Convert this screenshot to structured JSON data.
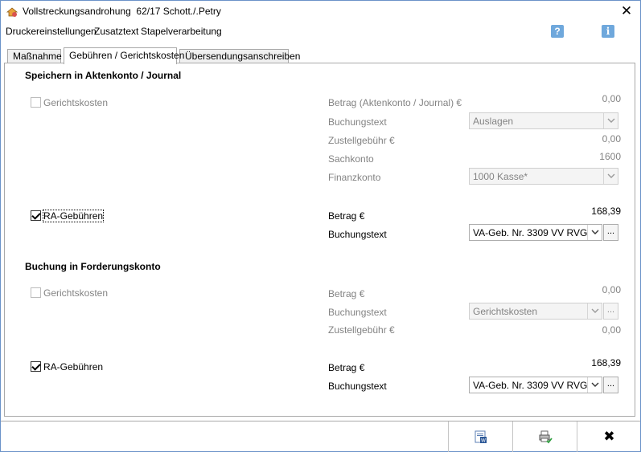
{
  "window": {
    "title": "Vollstreckungsandrohung  62/17 Schott./.Petry",
    "close_glyph": "✕"
  },
  "menu": {
    "items": [
      "Druckereinstellungen",
      "Zusatztext",
      "Stapelverarbeitung"
    ],
    "help_glyph": "?",
    "info_glyph": "i"
  },
  "tabs": [
    {
      "label": "Maßnahme",
      "active": false
    },
    {
      "label": "Gebühren / Gerichtskosten",
      "active": true
    },
    {
      "label": "Übersendungsanschreiben",
      "active": false
    }
  ],
  "section1": {
    "title": "Speichern in Aktenkonto / Journal",
    "gerichtskosten": {
      "label": "Gerichtskosten",
      "checked": false,
      "betrag_label": "Betrag (Aktenkonto / Journal) €",
      "betrag_value": "0,00",
      "buchungstext_label": "Buchungstext",
      "buchungstext_value": "Auslagen",
      "zustellgebuehr_label": "Zustellgebühr €",
      "zustellgebuehr_value": "0,00",
      "sachkonto_label": "Sachkonto",
      "sachkonto_value": "1600",
      "finanzkonto_label": "Finanzkonto",
      "finanzkonto_value": "1000 Kasse*"
    },
    "ra_gebuehren": {
      "label": "RA-Gebühren",
      "checked": true,
      "betrag_label": "Betrag €",
      "betrag_value": "168,39",
      "buchungstext_label": "Buchungstext",
      "buchungstext_value": "VA-Geb. Nr. 3309 VV RVG",
      "dots": "..."
    }
  },
  "section2": {
    "title": "Buchung in Forderungskonto",
    "gerichtskosten": {
      "label": "Gerichtskosten",
      "checked": false,
      "betrag_label": "Betrag €",
      "betrag_value": "0,00",
      "buchungstext_label": "Buchungstext",
      "buchungstext_value": "Gerichtskosten",
      "dots": "...",
      "zustellgebuehr_label": "Zustellgebühr €",
      "zustellgebuehr_value": "0,00"
    },
    "ra_gebuehren": {
      "label": "RA-Gebühren",
      "checked": true,
      "betrag_label": "Betrag €",
      "betrag_value": "168,39",
      "buchungstext_label": "Buchungstext",
      "buchungstext_value": "VA-Geb. Nr. 3309 VV RVG",
      "dots": "..."
    }
  },
  "bottom": {
    "close_glyph": "✖"
  },
  "colors": {
    "accent_blue": "#6fa8dc",
    "disabled_text": "#838383",
    "check_green": "#2e9e3e"
  }
}
